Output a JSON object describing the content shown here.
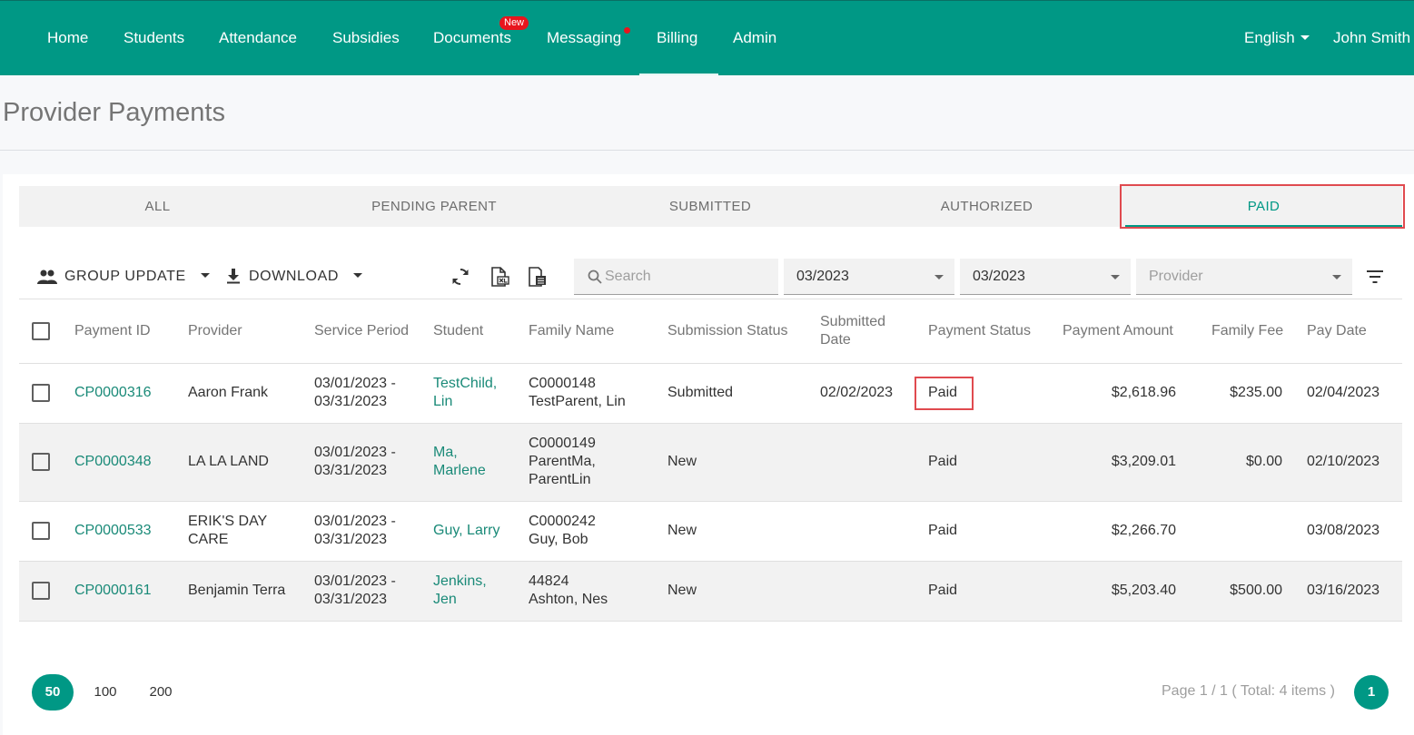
{
  "nav": {
    "items": [
      {
        "label": "Home"
      },
      {
        "label": "Students"
      },
      {
        "label": "Attendance"
      },
      {
        "label": "Subsidies"
      },
      {
        "label": "Documents",
        "badge": "New"
      },
      {
        "label": "Messaging"
      },
      {
        "label": "Billing",
        "active": true
      },
      {
        "label": "Admin"
      }
    ],
    "language": "English",
    "user": "John Smith",
    "colors": {
      "primary": "#009885",
      "badge": "#e8151d"
    }
  },
  "page": {
    "title": "Provider Payments"
  },
  "tabs": [
    {
      "label": "ALL"
    },
    {
      "label": "PENDING PARENT"
    },
    {
      "label": "SUBMITTED"
    },
    {
      "label": "AUTHORIZED"
    },
    {
      "label": "PAID",
      "active": true
    }
  ],
  "toolbar": {
    "group_update": "GROUP UPDATE",
    "download": "DOWNLOAD",
    "icons": [
      "refresh-icon",
      "export-excel-icon",
      "export-pdf-icon",
      "filter-icon"
    ],
    "search_placeholder": "Search",
    "from_period": "03/2023",
    "to_period": "03/2023",
    "provider_placeholder": "Provider"
  },
  "table": {
    "headers": {
      "payment_id": "Payment ID",
      "provider": "Provider",
      "service_period": "Service Period",
      "student": "Student",
      "family_name": "Family Name",
      "submission_status": "Submission Status",
      "submitted_date_1": "Submitted",
      "submitted_date_2": "Date",
      "payment_status": "Payment Status",
      "payment_amount": "Payment Amount",
      "family_fee": "Family Fee",
      "pay_date": "Pay Date"
    },
    "rows": [
      {
        "payment_id": "CP0000316",
        "provider": [
          "Aaron Frank"
        ],
        "service_period": [
          "03/01/2023 -",
          "03/31/2023"
        ],
        "student": [
          "TestChild,",
          "Lin"
        ],
        "family": [
          "C0000148",
          "TestParent, Lin"
        ],
        "submission_status": "Submitted",
        "submitted_date": "02/02/2023",
        "payment_status": "Paid",
        "payment_amount": "$2,618.96",
        "family_fee": "$235.00",
        "pay_date": "02/04/2023"
      },
      {
        "payment_id": "CP0000348",
        "provider": [
          "LA LA LAND"
        ],
        "service_period": [
          "03/01/2023 -",
          "03/31/2023"
        ],
        "student": [
          "Ma,",
          "Marlene"
        ],
        "family": [
          "C0000149",
          "ParentMa,",
          "ParentLin"
        ],
        "submission_status": "New",
        "submitted_date": "",
        "payment_status": "Paid",
        "payment_amount": "$3,209.01",
        "family_fee": "$0.00",
        "pay_date": "02/10/2023"
      },
      {
        "payment_id": "CP0000533",
        "provider": [
          "ERIK'S DAY",
          "CARE"
        ],
        "service_period": [
          "03/01/2023 -",
          "03/31/2023"
        ],
        "student": [
          "Guy, Larry"
        ],
        "family": [
          "C0000242",
          "Guy, Bob"
        ],
        "submission_status": "New",
        "submitted_date": "",
        "payment_status": "Paid",
        "payment_amount": "$2,266.70",
        "family_fee": "",
        "pay_date": "03/08/2023"
      },
      {
        "payment_id": "CP0000161",
        "provider": [
          "Benjamin Terra"
        ],
        "service_period": [
          "03/01/2023 -",
          "03/31/2023"
        ],
        "student": [
          "Jenkins,",
          "Jen"
        ],
        "family": [
          "44824",
          "Ashton, Nes"
        ],
        "submission_status": "New",
        "submitted_date": "",
        "payment_status": "Paid",
        "payment_amount": "$5,203.40",
        "family_fee": "$500.00",
        "pay_date": "03/16/2023"
      }
    ]
  },
  "footer": {
    "page_sizes": [
      "50",
      "100",
      "200"
    ],
    "page_info": "Page 1 / 1 ( Total: 4 items )",
    "current_page": "1"
  }
}
